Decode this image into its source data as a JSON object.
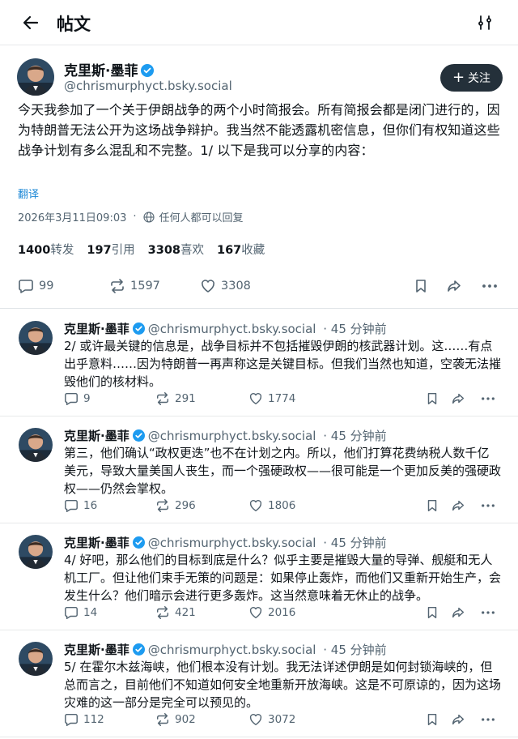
{
  "header": {
    "title": "帖文"
  },
  "post": {
    "author": "克里斯·墨菲",
    "handle": "@chrismurphyct.bsky.social",
    "follow_label": "关注",
    "text": "今天我参加了一个关于伊朗战争的两个小时简报会。所有简报会都是闭门进行的，因为特朗普无法公开为这场战争辩护。我当然不能透露机密信息，但你们有权知道这些战争计划有多么混乱和不完整。1/ 以下是我可以分享的内容：",
    "translate_label": "翻译",
    "timestamp": "2026年3月11日09:03",
    "reply_setting": "任何人都可以回复",
    "stats": [
      {
        "value": "1400",
        "label": "转发"
      },
      {
        "value": "197",
        "label": "引用"
      },
      {
        "value": "3308",
        "label": "喜欢"
      },
      {
        "value": "167",
        "label": "收藏"
      }
    ],
    "actions": {
      "replies": "99",
      "reposts": "1597",
      "likes": "3308"
    }
  },
  "replies": [
    {
      "author": "克里斯·墨菲",
      "handle": "@chrismurphyct.bsky.social",
      "time": "· 45 分钟前",
      "text": "2/ 或许最关键的信息是，战争目标并不包括摧毁伊朗的核武器计划。这……有点出乎意料……因为特朗普一再声称这是关键目标。但我们当然也知道，空袭无法摧毁他们的核材料。",
      "replies": "9",
      "reposts": "291",
      "likes": "1774"
    },
    {
      "author": "克里斯·墨菲",
      "handle": "@chrismurphyct.bsky.social",
      "time": "· 45 分钟前",
      "text": "第三，他们确认“政权更迭”也不在计划之内。所以，他们打算花费纳税人数千亿美元，导致大量美国人丧生，而一个强硬政权——很可能是一个更加反美的强硬政权——仍然会掌权。",
      "replies": "16",
      "reposts": "296",
      "likes": "1806"
    },
    {
      "author": "克里斯·墨菲",
      "handle": "@chrismurphyct.bsky.social",
      "time": "· 45 分钟前",
      "text": "4/ 好吧，那么他们的目标到底是什么？似乎主要是摧毁大量的导弹、舰艇和无人机工厂。但让他们束手无策的问题是：如果停止轰炸，而他们又重新开始生产，会发生什么？他们暗示会进行更多轰炸。这当然意味着无休止的战争。",
      "replies": "14",
      "reposts": "421",
      "likes": "2016"
    },
    {
      "author": "克里斯·墨菲",
      "handle": "@chrismurphyct.bsky.social",
      "time": "· 45 分钟前",
      "text": "5/ 在霍尔木兹海峡，他们根本没有计划。我无法详述伊朗是如何封锁海峡的，但总而言之，目前他们不知道如何安全地重新开放海峡。这是不可原谅的，因为这场灾难的这一部分是完全可以预见的。",
      "replies": "112",
      "reposts": "902",
      "likes": "3072"
    }
  ],
  "colors": {
    "accent": "#1d88d6",
    "verified": "#1d9bf0",
    "follow_bg": "#24303a",
    "muted": "#536471"
  }
}
